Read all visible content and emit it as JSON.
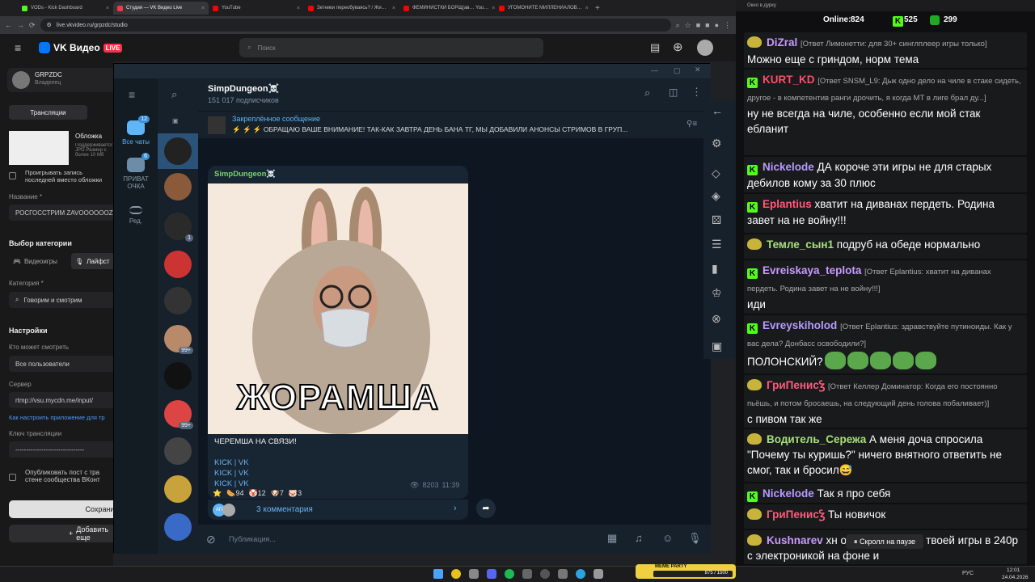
{
  "browser": {
    "tabs": [
      {
        "title": "VODs - Kick Dashboard",
        "color": "#53fc18"
      },
      {
        "title": "Студия — VK Видео Live",
        "color": "#ff3347"
      },
      {
        "title": "YouTube",
        "color": "#ff0000"
      },
      {
        "title": "Зетники переобуваясь? / Жи…",
        "color": "#ff0000"
      },
      {
        "title": "ФЕМИНИСТКИ БОРЩ(ав… You…",
        "color": "#ff0000"
      },
      {
        "title": "УГОМОНИТЕ МИЛЛЕНИАЛОВ…",
        "color": "#ff0000"
      }
    ],
    "new_tab": "+",
    "url": "live.vkvideo.ru/grpzdc/studio"
  },
  "vk": {
    "brand": "VK Видео",
    "live": "LIVE",
    "search_placeholder": "Поиск",
    "channel_name": "GRPZDC",
    "channel_role": "Владелец",
    "tab_broadcasts": "Трансляции",
    "cover_title": "Обложка",
    "cover_desc": "Поддерживается JPG Размер с более 10 Мб",
    "play_record": "Проигрывать запись последней вместо обложки",
    "name_label": "Название *",
    "name_value": "РОСГОССТРИМ ZAVOOOOOOZ",
    "category_choice": "Выбор категории",
    "cat_games": "Видеоигры",
    "cat_life": "Лайфст",
    "category_label": "Категория *",
    "category_value": "Говорим и смотрим",
    "settings": "Настройки",
    "who_can_watch": "Кто может смотреть",
    "who_value": "Все пользователи",
    "server_label": "Сервер",
    "server_value": "rtmp://vsu.mycdn.me/input/",
    "howto": "Как настроить приложение для тр",
    "key_label": "Ключ трансляции",
    "key_value": "--------------------------------",
    "publish_post": "Опубликовать пост с тра стене сообщества ВКонт",
    "save": "Сохрани",
    "add": "Добавить еще"
  },
  "telegram": {
    "folders": [
      {
        "label": "Все чаты",
        "badge": "12"
      },
      {
        "label": "ПРИВАТ ОЧКА",
        "badge": "6"
      },
      {
        "label": "Ред.",
        "badge": ""
      }
    ],
    "chat_badges": [
      "1",
      "99+",
      "99+"
    ],
    "channel_name": "SimpDungeon☠️",
    "subscribers": "151 017 подписчиков",
    "pinned_title": "Закреплённое сообщение",
    "pinned_text": "⚡ ⚡ ⚡ ОБРАЩАЮ ВАШЕ ВНИМАНИЕ!  ТАК-КАК ЗАВТРА ДЕНЬ БАНА ТГ, МЫ ДОБАВИЛИ АНОНСЫ СТРИМОВ В ГРУП...",
    "msg_author": "SimpDungeon☠️",
    "meme_caption": "ЖОРАМША",
    "msg_text": "ЧЕРЕМША НА СВЯЗИ!",
    "links": [
      "KICK | VK",
      "KICK | VK",
      "KICK | VK"
    ],
    "reactions": [
      {
        "icon": "⭐",
        "count": ""
      },
      {
        "icon": "🌭",
        "count": "94"
      },
      {
        "icon": "🤡",
        "count": "12"
      },
      {
        "icon": "🐶",
        "count": "7"
      },
      {
        "icon": "🐷",
        "count": "3"
      }
    ],
    "views": "8203",
    "time": "11:39",
    "comments_avatar": "АП",
    "comments": "3 комментария",
    "composer_placeholder": "Публикация..."
  },
  "chat": {
    "window_title": "Окно в дурку",
    "online_label": "Online:",
    "online": "824",
    "kick_count": "525",
    "other_count": "299",
    "messages": [
      {
        "name": "DiZral",
        "color": "#c99bff",
        "badge": "pepe",
        "reply": "[Ответ Лимонетти: для 30+ синглплеер игры только]",
        "text": "Можно еще с гриндом, норм тема"
      },
      {
        "name": "KURT_KD",
        "color": "#ff4d6a",
        "badge": "kick",
        "reply": "[Ответ SNSM_L9: Дык одно дело на чиле в стаке сидеть, другое - в компетентив ранги дрочить, я когда МТ в лиге брал ду...]",
        "text": "ну не всегда на чиле, особенно если мой стак ебланит"
      },
      {
        "name": "Nickelode",
        "color": "#b79bff",
        "badge": "kick",
        "reply": "",
        "text": "ДА короче эти игры не для старых дебилов кому за 30 плюс"
      },
      {
        "name": "Eplantius",
        "color": "#ff5b7a",
        "badge": "kick",
        "reply": "",
        "text": "хватит на диванах пердеть. Родина завет на не войну!!!"
      },
      {
        "name": "Темле_сын1",
        "color": "#a7e07a",
        "badge": "pepe",
        "reply": "",
        "text": "подруб на обеде     нормально"
      },
      {
        "name": "Evreiskaya_teplota",
        "color": "#c99bff",
        "badge": "kick",
        "reply": "[Ответ Eplantius: хватит на диванах пердеть. Родина завет на не войну!!!]",
        "text": "иди"
      },
      {
        "name": "Evreyskiholod",
        "color": "#b79bff",
        "badge": "kick",
        "reply": "[Ответ Eplantius: здравствуйте путиноиды. Как у вас дела? Донбасс освободили?]",
        "text": "ПОЛОНСКИЙ?"
      },
      {
        "name": "ГриПенисꝢ",
        "color": "#ff5b7a",
        "badge": "pepe",
        "reply": "[Ответ Келлер Доминатор: Когда его постоянно пьёшь, и потом бросаешь, на следующий день голова побаливает)]",
        "text": "с пивом так же"
      },
      {
        "name": "Водитель_Сережа",
        "color": "#a7e07a",
        "badge": "pepe",
        "reply": "",
        "text": "А меня доча спросила \"Почему ты куришь?\" ничего внятного ответить не смог, так и бросил😅"
      },
      {
        "name": "Nickelode",
        "color": "#b79bff",
        "badge": "kick",
        "reply": "",
        "text": "Так я про себя"
      },
      {
        "name": "ГриПенисꝢ",
        "color": "#ff5b7a",
        "badge": "pepe",
        "reply": "",
        "text": "Ты новичок"
      },
      {
        "name": "Kushnarev",
        "color": "#c99bff",
        "badge": "pepe",
        "reply": "",
        "text": "хн     о делал нарезку твоей игры в 240р с электроникой на фоне и"
      }
    ],
    "scroll_paused": "⏸ Скролл на паузе"
  },
  "taskbar": {
    "lang": "РУС",
    "time": "12:01",
    "date": "24.04.2026",
    "meme_party": "MEME PARTY",
    "meme_progress": "875 / 1500"
  }
}
